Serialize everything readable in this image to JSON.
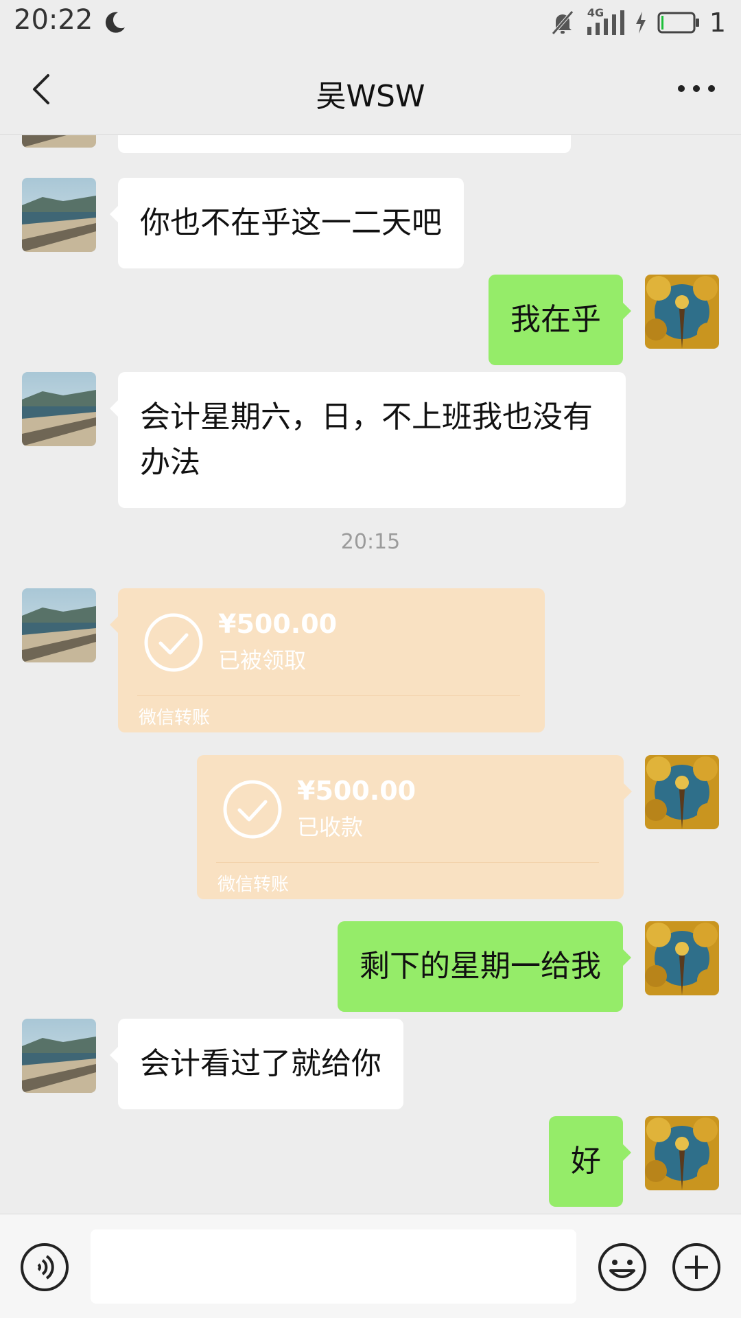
{
  "status_bar": {
    "time": "20:22",
    "network": "4G",
    "battery_level": "1"
  },
  "header": {
    "title": "吴WSW"
  },
  "messages": [
    {
      "from": "contact",
      "text": "你也不在乎这一二天吧"
    },
    {
      "from": "me",
      "text": "我在乎"
    },
    {
      "from": "contact",
      "text_line1": "会计星期六，日，不上班我也没有",
      "text_line2": "办法"
    },
    {
      "type": "time",
      "text": "20:15"
    },
    {
      "from": "contact",
      "type": "transfer",
      "amount": "¥500.00",
      "status": "已被领取",
      "label": "微信转账"
    },
    {
      "from": "me",
      "type": "transfer",
      "amount": "¥500.00",
      "status": "已收款",
      "label": "微信转账"
    },
    {
      "from": "me",
      "text": "剩下的星期一给我"
    },
    {
      "from": "contact",
      "text": "会计看过了就给你"
    },
    {
      "from": "me",
      "text": "好"
    }
  ],
  "input": {
    "value": ""
  },
  "colors": {
    "background": "#ededed",
    "bubble_in": "#ffffff",
    "bubble_out": "#95ec69",
    "transfer": "#f9e1c2"
  },
  "icons": {
    "back": "chevron-left-icon",
    "more": "more-dots-icon",
    "voice": "voice-icon",
    "emoji": "emoji-icon",
    "plus": "plus-icon"
  }
}
